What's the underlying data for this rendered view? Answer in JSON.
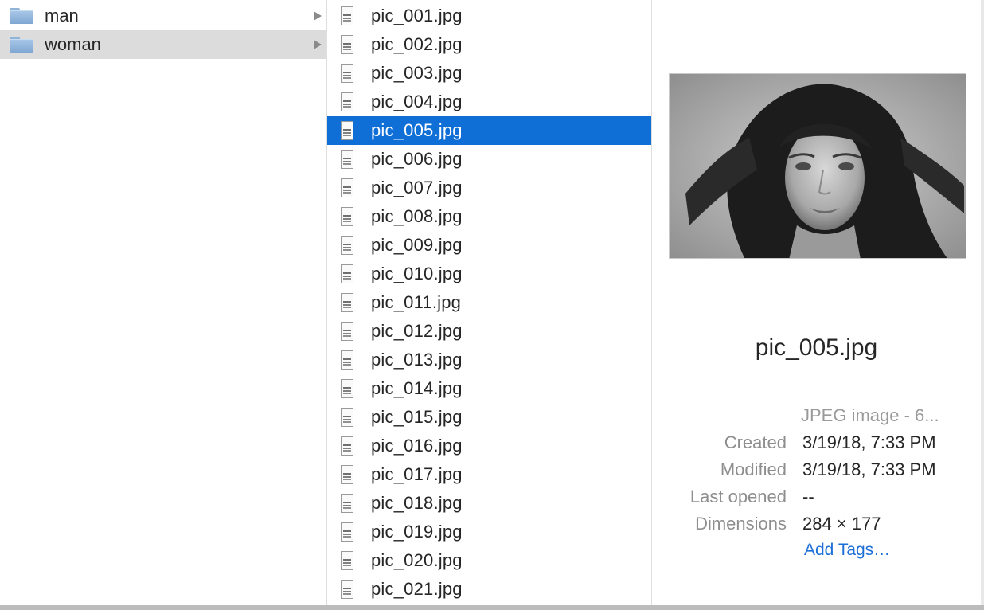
{
  "folders": [
    {
      "label": "man",
      "selected": false
    },
    {
      "label": "woman",
      "selected": true
    }
  ],
  "files": [
    {
      "name": "pic_001.jpg"
    },
    {
      "name": "pic_002.jpg"
    },
    {
      "name": "pic_003.jpg"
    },
    {
      "name": "pic_004.jpg"
    },
    {
      "name": "pic_005.jpg"
    },
    {
      "name": "pic_006.jpg"
    },
    {
      "name": "pic_007.jpg"
    },
    {
      "name": "pic_008.jpg"
    },
    {
      "name": "pic_009.jpg"
    },
    {
      "name": "pic_010.jpg"
    },
    {
      "name": "pic_011.jpg"
    },
    {
      "name": "pic_012.jpg"
    },
    {
      "name": "pic_013.jpg"
    },
    {
      "name": "pic_014.jpg"
    },
    {
      "name": "pic_015.jpg"
    },
    {
      "name": "pic_016.jpg"
    },
    {
      "name": "pic_017.jpg"
    },
    {
      "name": "pic_018.jpg"
    },
    {
      "name": "pic_019.jpg"
    },
    {
      "name": "pic_020.jpg"
    },
    {
      "name": "pic_021.jpg"
    }
  ],
  "selected_file": "pic_005.jpg",
  "preview": {
    "title": "pic_005.jpg",
    "kind": "JPEG image - 6...",
    "created_label": "Created",
    "created_value": "3/19/18, 7:33 PM",
    "modified_label": "Modified",
    "modified_value": "3/19/18, 7:33 PM",
    "last_opened_label": "Last opened",
    "last_opened_value": "--",
    "dimensions_label": "Dimensions",
    "dimensions_value": "284 × 177",
    "add_tags": "Add Tags…"
  },
  "colors": {
    "selection": "#0f6fd7",
    "folder_selection": "#dcdcdc",
    "link": "#1b6fd6"
  }
}
